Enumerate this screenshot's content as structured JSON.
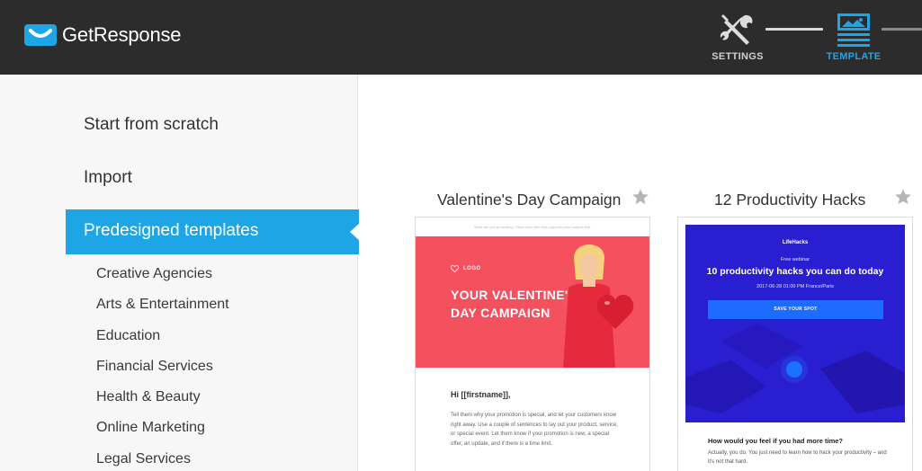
{
  "brand": {
    "name": "GetResponse",
    "accent": "#1ea5e6"
  },
  "steps": [
    {
      "label": "SETTINGS",
      "icon": "settings-tools-icon",
      "state": "done"
    },
    {
      "label": "TEMPLATE",
      "icon": "template-icon",
      "state": "active"
    }
  ],
  "sidebar": {
    "start_from_scratch": "Start from scratch",
    "import": "Import",
    "predesigned": "Predesigned templates",
    "categories": [
      "Creative Agencies",
      "Arts & Entertainment",
      "Education",
      "Financial Services",
      "Health & Beauty",
      "Online Marketing",
      "Legal Services"
    ]
  },
  "templates": [
    {
      "title": "Valentine's Day Campaign",
      "preheader": "What are you promoting? Short intro here that pops into your subject line.",
      "logo": "LOGO",
      "headline_1": "YOUR VALENTINE'S",
      "headline_2": "DAY CAMPAIGN",
      "greeting": "Hi [[firstname]],",
      "body": "Tell them why your promotion is special, and let your customers know right away. Use a couple of sentences to lay out your product, service, or special event. Let them know if your promotion is new, a special offer, an update, and if there is a time limit."
    },
    {
      "title": "12 Productivity Hacks",
      "brand": "LifeHacks",
      "kicker": "Free webinar",
      "headline": "10 productivity hacks you can do today",
      "date": "2017-06-28 01:00 PM France/Paris",
      "cta": "SAVE YOUR SPOT",
      "question": "How would you feel if you had more time?",
      "body": "Actually, you do. You just need to learn how to hack your productivity – and it's not that hard."
    }
  ]
}
